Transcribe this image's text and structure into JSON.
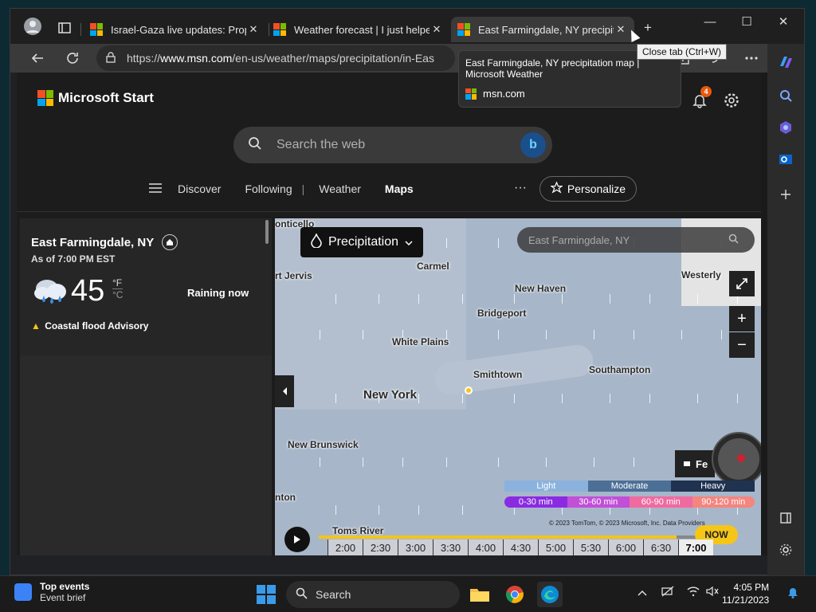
{
  "browser": {
    "tabs": [
      {
        "title": "Israel-Gaza live updates: Propo",
        "close": "✕"
      },
      {
        "title": "Weather forecast | I just helped",
        "close": "✕"
      },
      {
        "title": "East Farmingdale, NY precipitati",
        "close": "✕"
      }
    ],
    "new_tab": "+",
    "window": {
      "minimize": "—",
      "maximize": "☐",
      "close": "✕"
    },
    "address": {
      "scheme": "https://",
      "host": "www.msn.com",
      "path": "/en-us/weather/maps/precipitation/in-Eas"
    },
    "tooltip": {
      "title": "East Farmingdale, NY precipitation map | Microsoft Weather",
      "site": "msn.com"
    },
    "close_tab_tip": "Close tab (Ctrl+W)"
  },
  "header": {
    "brand": "Microsoft Start",
    "notifications_count": "4",
    "search_placeholder": "Search the web",
    "nav": [
      "Discover",
      "Following",
      "|",
      "Weather",
      "Maps"
    ],
    "more": "···",
    "personalize": "Personalize"
  },
  "weather": {
    "location": "East Farmingdale, NY",
    "as_of": "As of 7:00 PM EST",
    "temperature": "45",
    "unit_f": "°F",
    "unit_c": "°C",
    "condition": "Raining now",
    "alert": "Coastal flood Advisory"
  },
  "map": {
    "layer": "Precipitation",
    "search_placeholder": "East Farmingdale, NY",
    "labels": [
      "onticello",
      "rt Jervis",
      "Carmel",
      "New Haven",
      "Westerly",
      "Bridgeport",
      "White Plains",
      "Smithtown",
      "Southampton",
      "New York",
      "New Brunswick",
      "nton",
      "Toms River"
    ],
    "legend_intensity": [
      "Light",
      "Moderate",
      "Heavy"
    ],
    "legend_duration": [
      "0-30 min",
      "30-60 min",
      "60-90 min",
      "90-120 min"
    ],
    "legend_colors": [
      "#8a2be2",
      "#c14fd8",
      "#f06aa0",
      "#f4857f"
    ],
    "copyright": "© 2023 TomTom, © 2023 Microsoft, Inc. Data Providers",
    "now_label": "NOW",
    "fe_label": "Fe",
    "times": [
      "2:00",
      "2:30",
      "3:00",
      "3:30",
      "4:00",
      "4:30",
      "5:00",
      "5:30",
      "6:00",
      "6:30",
      "7:00"
    ],
    "progress": 0.86
  },
  "taskbar": {
    "news_title": "Top events",
    "news_sub": "Event brief",
    "search": "Search",
    "time": "4:05 PM",
    "date": "11/21/2023"
  }
}
